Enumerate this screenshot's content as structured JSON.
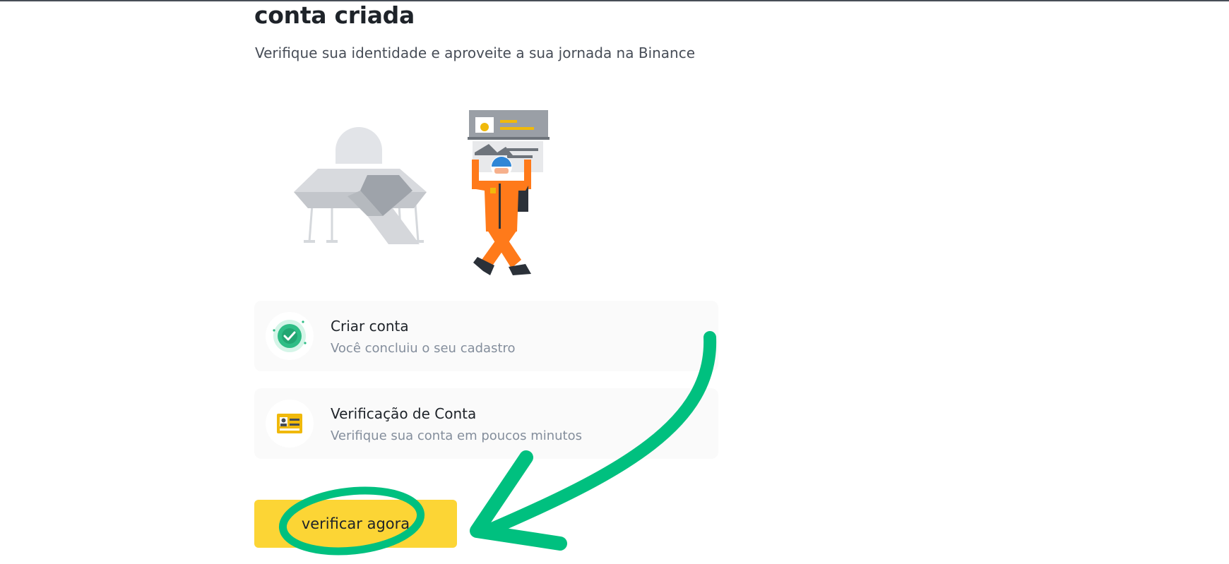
{
  "page": {
    "title": "conta criada",
    "subtitle": "Verifique sua identidade e aproveite a sua jornada na Binance"
  },
  "steps": [
    {
      "title": "Criar conta",
      "description": "Você concluiu o seu cadastro",
      "status": "completed",
      "icon": "check-circle-icon"
    },
    {
      "title": "Verificação de Conta",
      "description": "Verifique sua conta em poucos minutos",
      "status": "pending",
      "icon": "id-card-icon"
    }
  ],
  "cta": {
    "label": "verificar agora"
  },
  "colors": {
    "accent": "#FCD535",
    "annotation": "#00C07F",
    "success": "#2EBD85",
    "astronaut": "#FF7A1A"
  },
  "illustration": {
    "icons": [
      "ufo-icon",
      "astronaut-icon",
      "id-document-icon"
    ]
  }
}
